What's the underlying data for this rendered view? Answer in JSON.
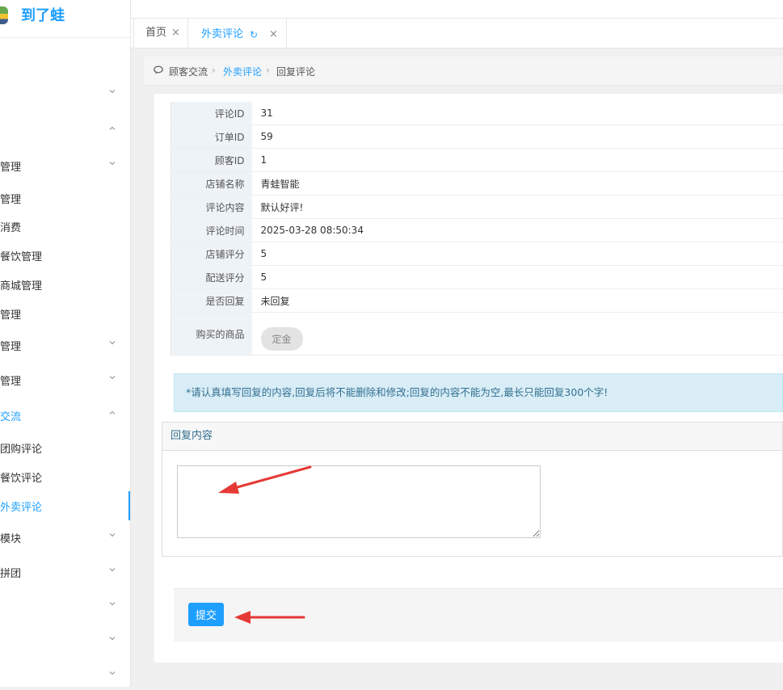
{
  "brand": {
    "name": "到了蛙"
  },
  "sidebar": {
    "items": [
      {
        "label": "",
        "chevron": ""
      },
      {
        "label": "",
        "chevron": "down"
      },
      {
        "label": "",
        "chevron": "up"
      },
      {
        "label": "管理",
        "chevron": "down"
      },
      {
        "label": "管理",
        "chevron": ""
      },
      {
        "label": "消费",
        "chevron": ""
      },
      {
        "label": "餐饮管理",
        "chevron": ""
      },
      {
        "label": "商城管理",
        "chevron": ""
      },
      {
        "label": "管理",
        "chevron": ""
      },
      {
        "label": "管理",
        "chevron": "down"
      },
      {
        "label": "管理",
        "chevron": "down"
      },
      {
        "label": "交流",
        "chevron": "up",
        "state": "active-group"
      },
      {
        "label": "团购评论",
        "chevron": ""
      },
      {
        "label": "餐饮评论",
        "chevron": ""
      },
      {
        "label": "外卖评论",
        "chevron": "",
        "state": "current"
      },
      {
        "label": "模块",
        "chevron": "down"
      },
      {
        "label": "拼团",
        "chevron": "down"
      },
      {
        "label": "",
        "chevron": "down"
      },
      {
        "label": "",
        "chevron": "down"
      },
      {
        "label": "",
        "chevron": "down"
      }
    ]
  },
  "tabs": {
    "home": {
      "label": "首页",
      "close": "×"
    },
    "active": {
      "label": "外卖评论",
      "close": "×",
      "refresh": "↻"
    }
  },
  "breadcrumb": {
    "icon": "comment-icon",
    "items": [
      "顾客交流",
      "外卖评论",
      "回复评论"
    ],
    "sep": "›"
  },
  "details": {
    "rows": [
      {
        "key": "评论ID",
        "value": "31"
      },
      {
        "key": "订单ID",
        "value": "59"
      },
      {
        "key": "顾客ID",
        "value": "1"
      },
      {
        "key": "店铺名称",
        "value": "青蛙智能"
      },
      {
        "key": "评论内容",
        "value": "默认好评!"
      },
      {
        "key": "评论时间",
        "value": "2025-03-28 08:50:34"
      },
      {
        "key": "店铺评分",
        "value": "5"
      },
      {
        "key": "配送评分",
        "value": "5"
      },
      {
        "key": "是否回复",
        "value": "未回复"
      }
    ],
    "goods": {
      "key": "购买的商品",
      "tag": "定金"
    }
  },
  "tip": "*请认真填写回复的内容,回复后将不能删除和修改;回复的内容不能为空,最长只能回复300个字!",
  "reply": {
    "title": "回复内容",
    "value": "",
    "placeholder": ""
  },
  "submit": {
    "label": "提交"
  },
  "colors": {
    "accent": "#1e9fff",
    "arrow": "#e53935",
    "tip_bg": "#d9edf7"
  }
}
